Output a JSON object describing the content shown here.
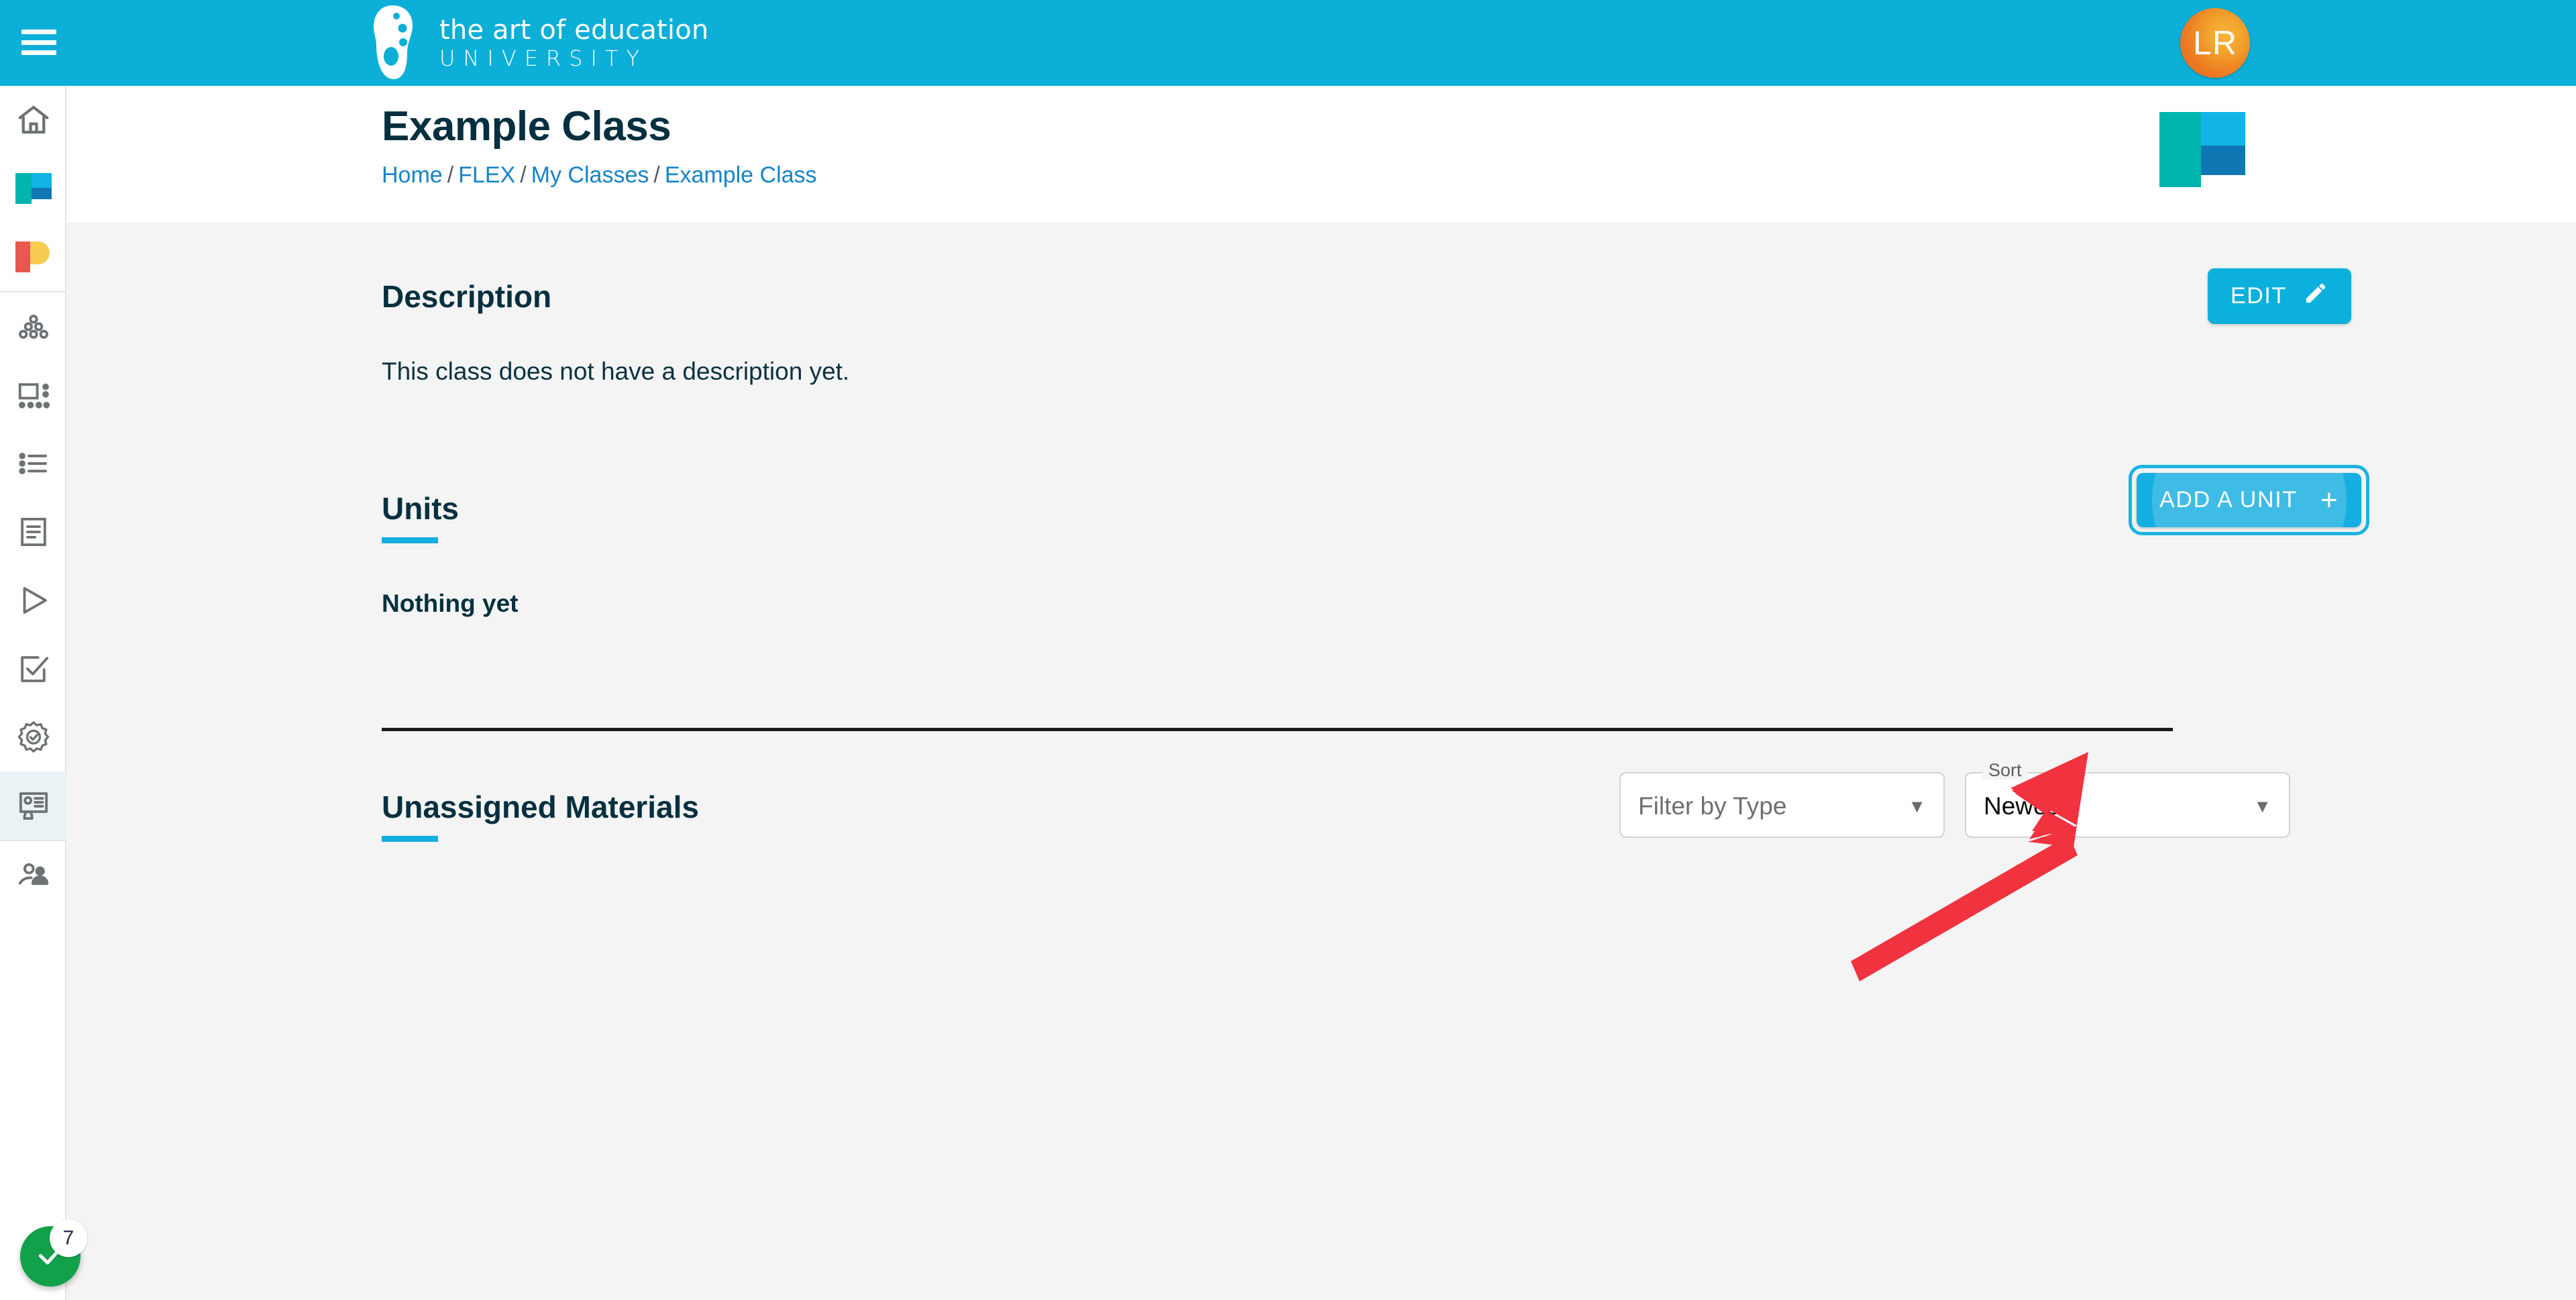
{
  "appbar": {
    "menu_icon": "hamburger-menu-icon",
    "brand_line1": "the art of education",
    "brand_line2": "UNIVERSITY",
    "brand_logo_icon": "palette-icon",
    "avatar_initials": "LR",
    "background_color": "#0BAFD8"
  },
  "sidebar": {
    "items": [
      {
        "name": "home",
        "icon": "home-icon",
        "active": false
      },
      {
        "name": "flex",
        "icon": "flex-logo-icon",
        "active": false
      },
      {
        "name": "pro",
        "icon": "pro-logo-icon",
        "active": false
      },
      {
        "name": "community",
        "icon": "group-dots-icon",
        "active": false
      },
      {
        "name": "layout",
        "icon": "layout-grid-icon",
        "active": false
      },
      {
        "name": "list",
        "icon": "bulleted-list-icon",
        "active": false
      },
      {
        "name": "article",
        "icon": "document-icon",
        "active": false
      },
      {
        "name": "video",
        "icon": "play-icon",
        "active": false
      },
      {
        "name": "assessment",
        "icon": "checkbox-edit-icon",
        "active": false
      },
      {
        "name": "certificate",
        "icon": "badge-check-icon",
        "active": false
      },
      {
        "name": "classes",
        "icon": "presentation-id-card-icon",
        "active": true
      },
      {
        "name": "students",
        "icon": "people-icon",
        "active": false
      }
    ],
    "active_background": "#e9f2f5"
  },
  "header": {
    "title": "Example Class",
    "breadcrumb": [
      {
        "label": "Home",
        "link": true
      },
      {
        "label": "FLEX",
        "link": true
      },
      {
        "label": "My Classes",
        "link": true
      },
      {
        "label": "Example Class",
        "link": true
      }
    ],
    "breadcrumb_separator": "/",
    "product_logo_icon": "flex-logo-icon",
    "link_color": "#1583c7",
    "title_color": "#06303f"
  },
  "description": {
    "heading": "Description",
    "body": "This class does not have a description yet.",
    "edit_label": "EDIT",
    "edit_icon": "pencil-icon",
    "edit_color": "#0cb0dc"
  },
  "units": {
    "heading": "Units",
    "empty_text": "Nothing yet",
    "add_label": "ADD A UNIT",
    "add_icon": "plus-icon",
    "add_color": "#14aee0",
    "focus_ring_color": "#19b4e0",
    "accent_underline": "#14ade0"
  },
  "annotation": {
    "type": "arrow",
    "color": "#f0333f",
    "points_to": "add-a-unit-button"
  },
  "materials": {
    "heading": "Unassigned Materials",
    "filter": {
      "placeholder": "Filter by Type",
      "value": "",
      "arrow_icon": "chevron-down-icon"
    },
    "sort": {
      "label": "Sort",
      "value": "Newest",
      "arrow_icon": "chevron-down-icon"
    }
  },
  "widget": {
    "icon": "check-icon",
    "badge_count": "7",
    "color": "#12a14b"
  }
}
